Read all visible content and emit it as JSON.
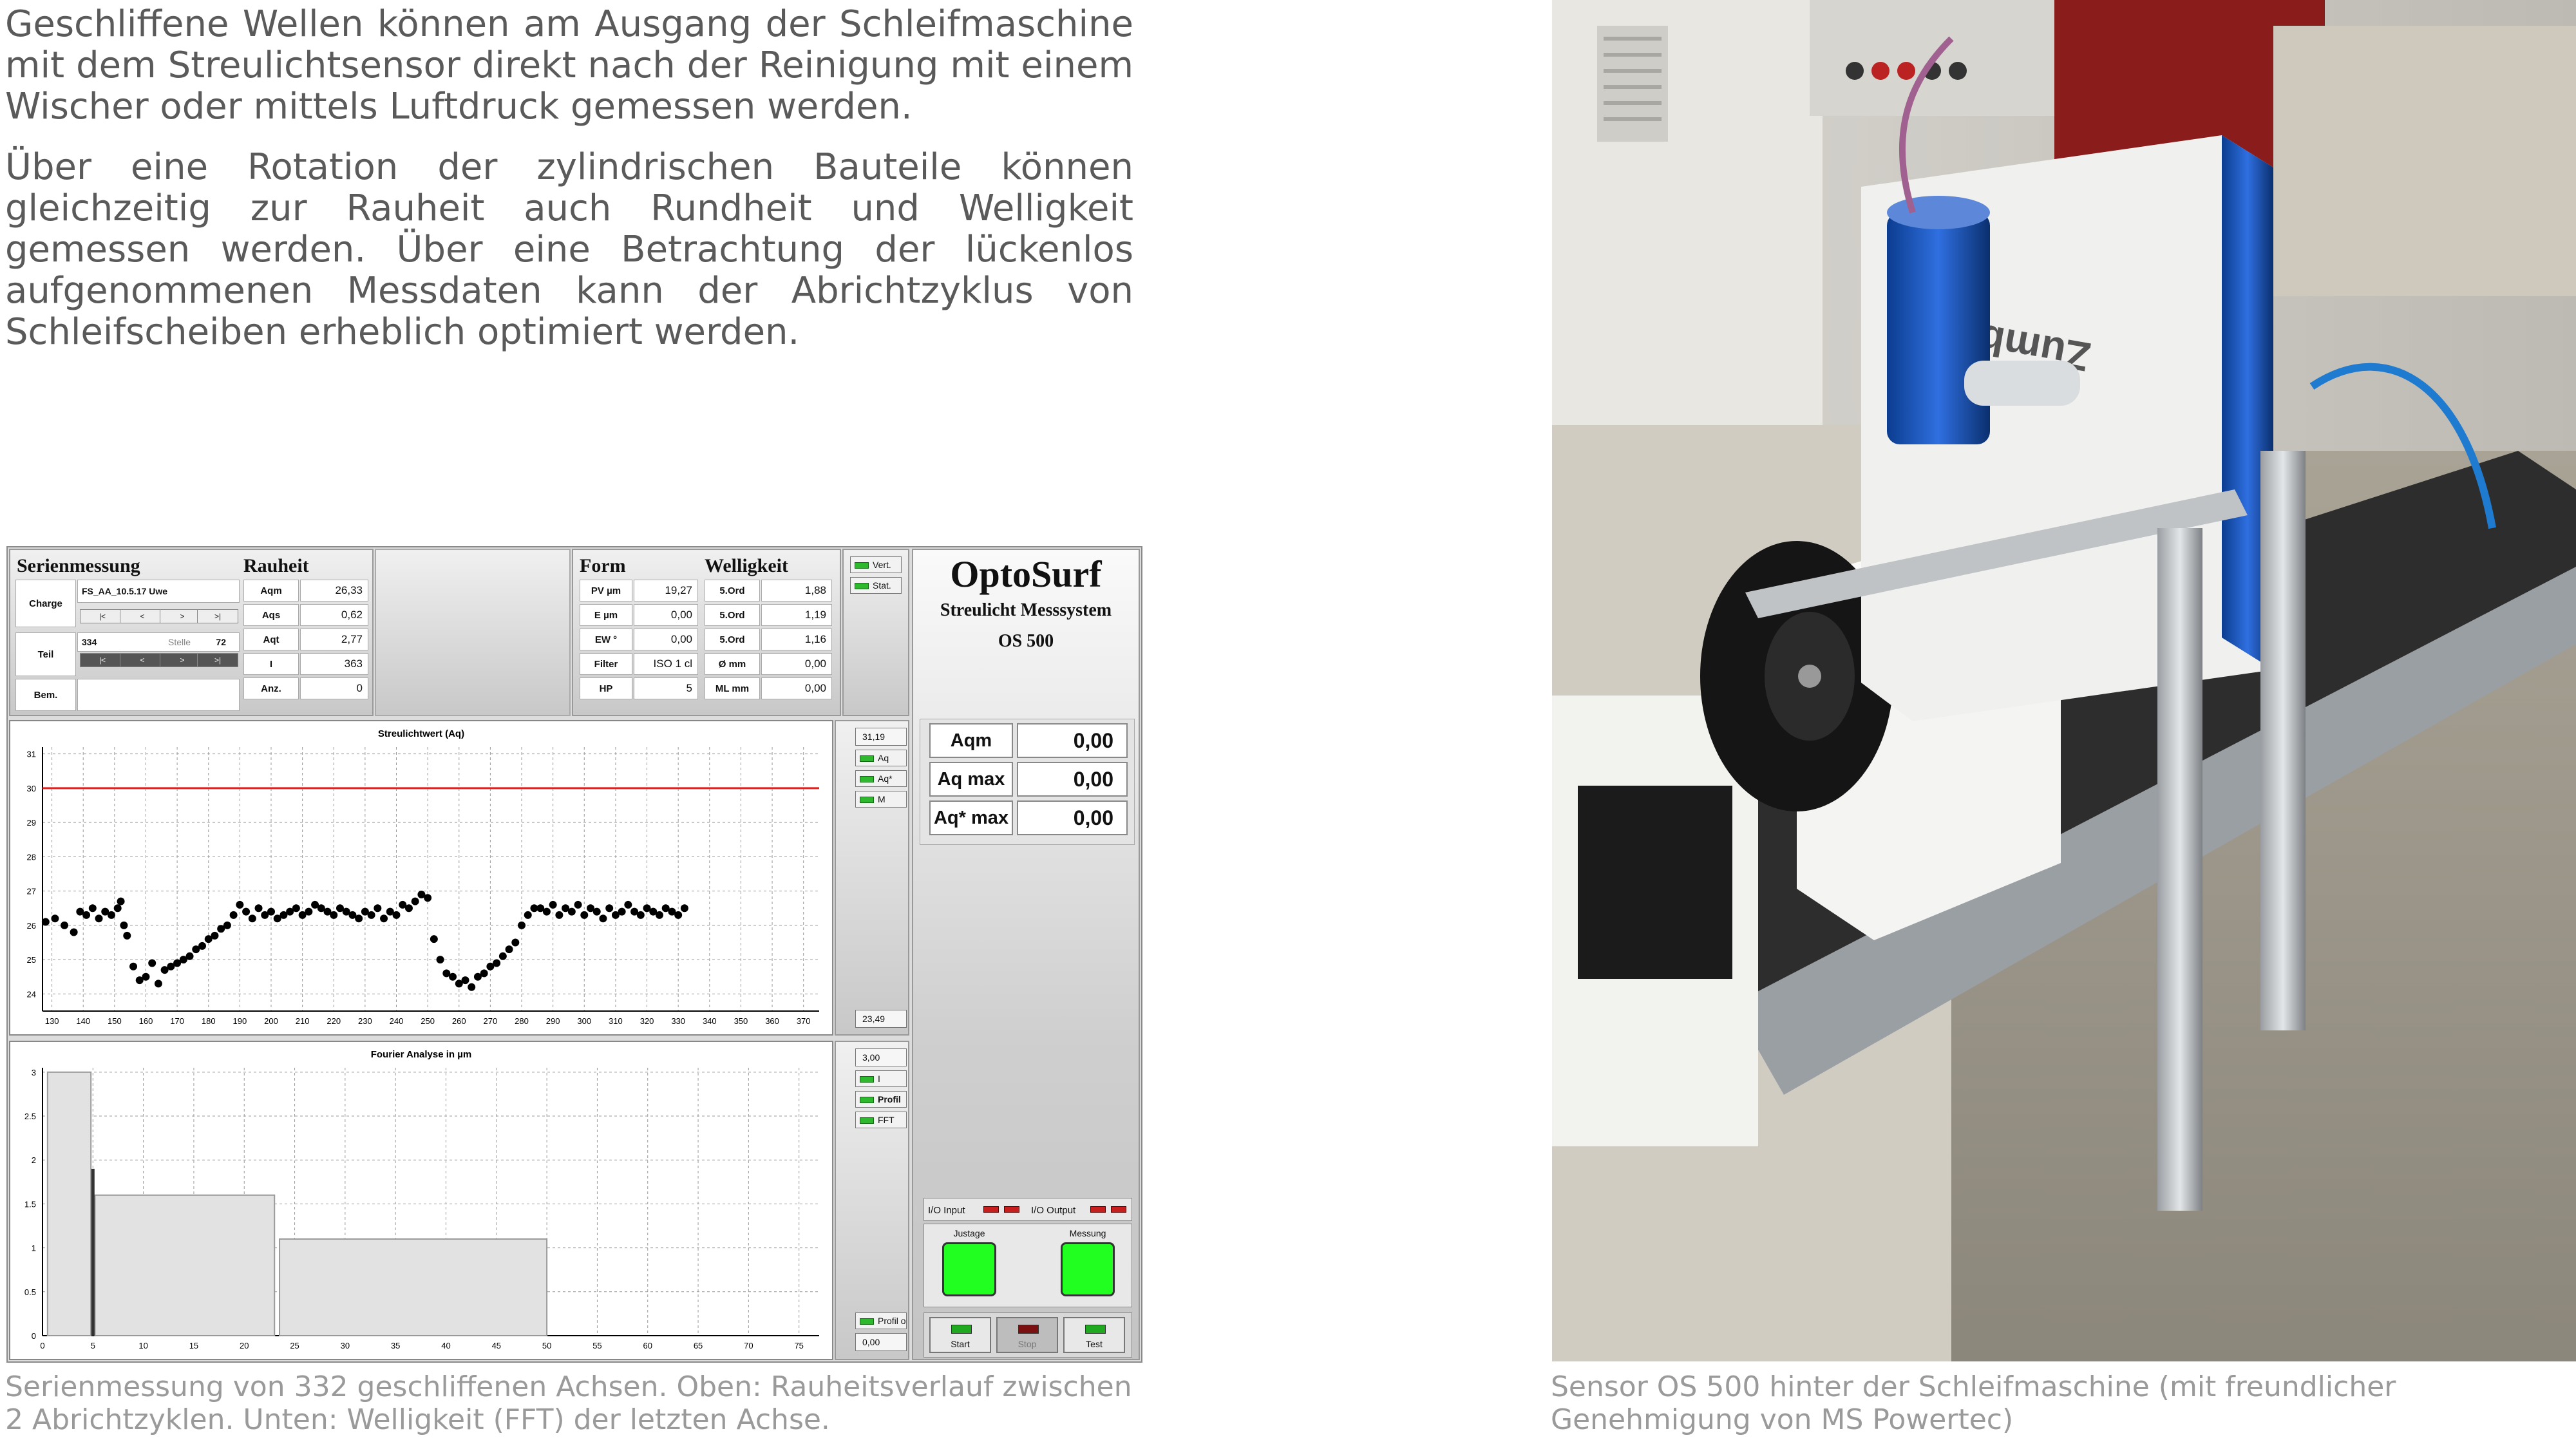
{
  "intro": {
    "p1": "Geschliffene Wellen können am Ausgang der Schleifmaschine mit dem Streulichtsensor direkt nach der Reinigung mit einem Wischer oder mittels Luftdruck gemessen werden.",
    "p2": "Über eine Rotation der zylindrischen Bauteile können gleichzeitig zur Rauheit auch Rundheit und Welligkeit gemessen werden. Über eine Betrachtung der lückenlos aufgenommenen Messdaten kann der Abrichtzyklus von Schleifscheiben erheblich optimiert werden."
  },
  "captions": {
    "left": "Serienmessung von 332 geschliffenen Achsen. Oben: Rauheitsverlauf zwischen 2 Abrichtzyklen. Unten: Welligkeit (FFT) der letzten Achse.",
    "right": "Sensor OS 500 hinter der Schleifmaschine (mit freundlicher Genehmigung von MS Powertec)"
  },
  "app": {
    "serie": {
      "title": "Serienmessung",
      "charge_label": "Charge",
      "charge_value": "FS_AA_10.5.17 Uwe",
      "teil_label": "Teil",
      "teil_value": "334",
      "stelle_label": "Stelle",
      "stelle_value": "72",
      "bem_label": "Bem.",
      "nav": [
        "|<",
        "<",
        ">",
        ">|"
      ]
    },
    "rauheit": {
      "title": "Rauheit",
      "rows": [
        {
          "label": "Aqm",
          "value": "26,33"
        },
        {
          "label": "Aqs",
          "value": "0,62"
        },
        {
          "label": "Aqt",
          "value": "2,77"
        },
        {
          "label": "I",
          "value": "363"
        },
        {
          "label": "Anz.",
          "value": "0"
        }
      ]
    },
    "form": {
      "title": "Form",
      "rows": [
        {
          "label": "PV µm",
          "value": "19,27"
        },
        {
          "label": "E µm",
          "value": "0,00"
        },
        {
          "label": "EW °",
          "value": "0,00"
        },
        {
          "label": "Filter",
          "value": "ISO 1 cl"
        },
        {
          "label": "HP",
          "value": "5"
        }
      ]
    },
    "welligkeit": {
      "title": "Welligkeit",
      "rows": [
        {
          "label": "5.Ord",
          "value": "1,88"
        },
        {
          "label": "5.Ord",
          "value": "1,19"
        },
        {
          "label": "5.Ord",
          "value": "1,16"
        },
        {
          "label": "Ø mm",
          "value": "0,00"
        },
        {
          "label": "ML mm",
          "value": "0,00"
        }
      ]
    },
    "top_buttons": [
      "Vert.",
      "Stat."
    ],
    "brand": {
      "name": "OptoSurf",
      "sub": "Streulicht Messsystem",
      "model": "OS 500"
    },
    "results": [
      {
        "label": "Aqm",
        "value": "0,00"
      },
      {
        "label": "Aq max",
        "value": "0,00"
      },
      {
        "label": "Aq* max",
        "value": "0,00"
      }
    ],
    "io": {
      "input_label": "I/O Input",
      "output_label": "I/O Output"
    },
    "status": {
      "justage_label": "Justage",
      "messung_label": "Messung"
    },
    "controls": [
      "Start",
      "Stop",
      "Test"
    ],
    "chart1_side": {
      "top": "31,19",
      "bottom": "23,49",
      "buttons": [
        "Aq",
        "Aq*",
        "M"
      ]
    },
    "chart2_side": {
      "top": "3,00",
      "bottom": "0,00",
      "buttons": [
        "I",
        "Profil",
        "FFT"
      ],
      "bottom_button": "Profil o"
    }
  },
  "chart_data": [
    {
      "type": "scatter",
      "title": "Streulichtwert (Aq)",
      "xlabel": "",
      "ylabel": "",
      "xlim": [
        127,
        375
      ],
      "ylim": [
        23.5,
        31.2
      ],
      "xticks": [
        130,
        140,
        150,
        160,
        170,
        180,
        190,
        200,
        210,
        220,
        230,
        240,
        250,
        260,
        270,
        280,
        290,
        300,
        310,
        320,
        330,
        340,
        350,
        360,
        370
      ],
      "yticks": [
        24,
        25,
        26,
        27,
        28,
        29,
        30,
        31
      ],
      "grid": true,
      "threshold": 30,
      "threshold_color": "#dd2222",
      "series": [
        {
          "x": [
            128,
            131,
            134,
            137,
            139,
            141,
            143,
            145,
            147,
            149,
            151,
            152,
            153,
            154,
            156,
            158,
            160,
            162,
            164,
            166,
            168,
            170,
            172,
            174,
            176,
            178,
            180,
            182,
            184,
            186,
            188,
            190,
            192,
            194,
            196,
            198,
            200,
            202,
            204,
            206,
            208,
            210,
            212,
            214,
            216,
            218,
            220,
            222,
            224,
            226,
            228,
            230,
            232,
            234,
            236,
            238,
            240,
            242,
            244,
            246,
            248,
            250,
            252,
            254,
            256,
            258,
            260,
            262,
            264,
            266,
            268,
            270,
            272,
            274,
            276,
            278,
            280,
            282,
            284,
            286,
            288,
            290,
            292,
            294,
            296,
            298,
            300,
            302,
            304,
            306,
            308,
            310,
            312,
            314,
            316,
            318,
            320,
            322,
            324,
            326,
            328,
            330,
            332
          ],
          "y": [
            26.1,
            26.2,
            26.0,
            25.8,
            26.4,
            26.3,
            26.5,
            26.2,
            26.4,
            26.3,
            26.5,
            26.7,
            26.0,
            25.7,
            24.8,
            24.4,
            24.5,
            24.9,
            24.3,
            24.7,
            24.8,
            24.9,
            25.0,
            25.1,
            25.3,
            25.4,
            25.6,
            25.7,
            25.9,
            26.0,
            26.3,
            26.6,
            26.4,
            26.2,
            26.5,
            26.3,
            26.4,
            26.2,
            26.3,
            26.4,
            26.5,
            26.3,
            26.4,
            26.6,
            26.5,
            26.4,
            26.3,
            26.5,
            26.4,
            26.3,
            26.2,
            26.4,
            26.3,
            26.5,
            26.2,
            26.4,
            26.3,
            26.6,
            26.5,
            26.7,
            26.9,
            26.8,
            25.6,
            25.0,
            24.6,
            24.5,
            24.3,
            24.4,
            24.2,
            24.5,
            24.6,
            24.8,
            24.9,
            25.1,
            25.3,
            25.5,
            26.0,
            26.3,
            26.5,
            26.5,
            26.4,
            26.6,
            26.3,
            26.5,
            26.4,
            26.6,
            26.3,
            26.5,
            26.4,
            26.2,
            26.5,
            26.3,
            26.4,
            26.6,
            26.4,
            26.3,
            26.5,
            26.4,
            26.3,
            26.5,
            26.4,
            26.3,
            26.5
          ]
        }
      ]
    },
    {
      "type": "bar",
      "title": "Fourier Analyse in µm",
      "xlabel": "",
      "ylabel": "",
      "xlim": [
        0,
        77
      ],
      "ylim": [
        0,
        3.05
      ],
      "xticks": [
        0,
        5,
        10,
        15,
        20,
        25,
        30,
        35,
        40,
        45,
        50,
        55,
        60,
        65,
        70,
        75
      ],
      "yticks": [
        0,
        0.5,
        1,
        1.5,
        2,
        2.5,
        3
      ],
      "grid": true,
      "bands": [
        {
          "x0": 0.5,
          "x1": 4.8,
          "value": 3.0
        },
        {
          "x0": 5.2,
          "x1": 23.0,
          "value": 1.6
        },
        {
          "x0": 23.5,
          "x1": 50.0,
          "value": 1.1
        }
      ],
      "spikes": [
        {
          "x": 5.0,
          "value": 1.9
        }
      ]
    }
  ]
}
